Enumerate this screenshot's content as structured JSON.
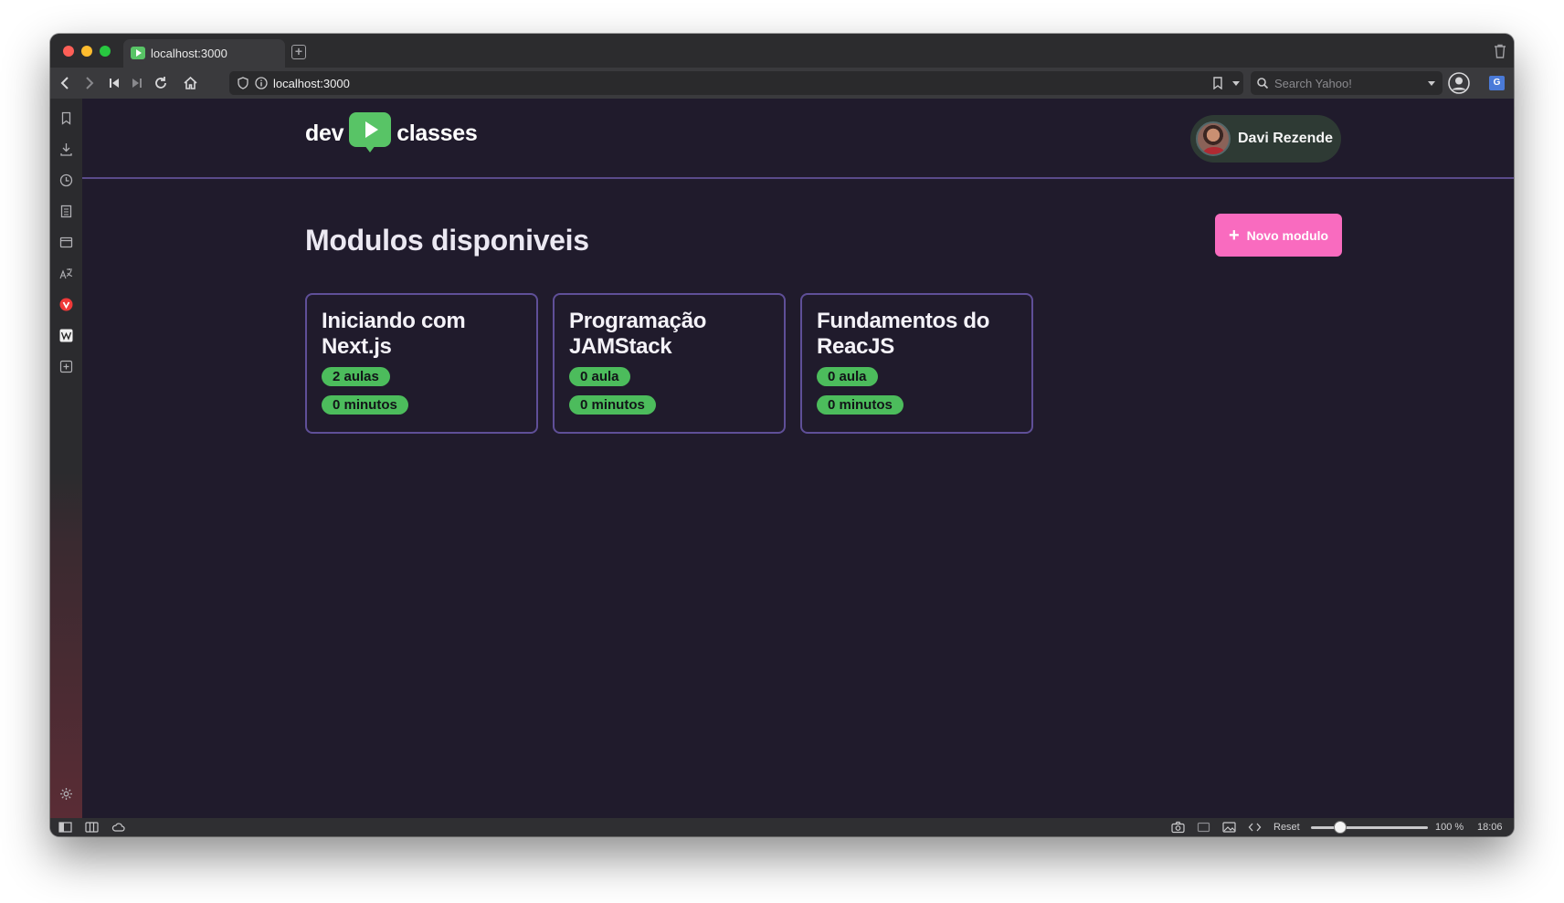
{
  "browser": {
    "tab_title": "localhost:3000",
    "url": "localhost:3000",
    "search_placeholder": "Search Yahoo!",
    "statusbar": {
      "reset_label": "Reset",
      "zoom": "100 %",
      "clock": "18:06"
    }
  },
  "app": {
    "logo_left": "dev",
    "logo_right": "classes",
    "user_name": "Davi Rezende",
    "page_title": "Modulos disponiveis",
    "new_module_label": "Novo modulo",
    "modules": [
      {
        "title": "Iniciando com Next.js",
        "lessons": "2 aulas",
        "duration": "0 minutos"
      },
      {
        "title": "Programação JAMStack",
        "lessons": "0 aula",
        "duration": "0 minutos"
      },
      {
        "title": "Fundamentos do ReacJS",
        "lessons": "0 aula",
        "duration": "0 minutos"
      }
    ]
  },
  "colors": {
    "page_bg": "#201b2c",
    "brand_green": "#58c466",
    "accent_pink": "#f96bbf",
    "card_border": "#5f4f98"
  }
}
